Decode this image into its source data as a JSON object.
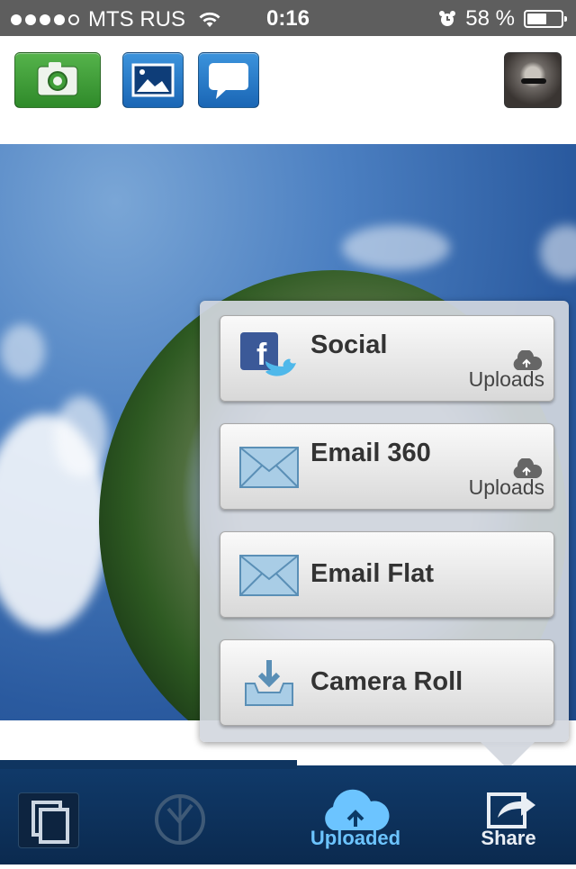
{
  "status_bar": {
    "carrier": "MTS RUS",
    "time": "0:16",
    "battery": "58 %",
    "battery_level": 0.58,
    "signal_bars_filled": 4,
    "signal_bars_total": 5
  },
  "toolbar": {
    "buttons": [
      {
        "name": "camera-button",
        "icon": "camera-icon",
        "color": "#3f9d38"
      },
      {
        "name": "gallery-button",
        "icon": "image-icon",
        "color": "#2a7dcc"
      },
      {
        "name": "chat-button",
        "icon": "speech-bubble-icon",
        "color": "#2a7dcc"
      }
    ],
    "avatar": "profile-avatar"
  },
  "share_menu": {
    "items": [
      {
        "label": "Social",
        "sub": "Uploads",
        "icon": "facebook-twitter-icon",
        "cloud": "cloud-upload-icon"
      },
      {
        "label": "Email 360",
        "sub": "Uploads",
        "icon": "envelope-icon",
        "cloud": "cloud-upload-icon"
      },
      {
        "label": "Email Flat",
        "icon": "envelope-icon"
      },
      {
        "label": "Camera Roll",
        "icon": "download-tray-icon"
      }
    ]
  },
  "tabbar": {
    "tabs": [
      {
        "name": "copy",
        "icon": "copy-icon"
      },
      {
        "name": "rotate",
        "icon": "rotate-icon"
      },
      {
        "label": "Uploaded",
        "icon": "cloud-upload-icon",
        "color": "#6cc4ff"
      },
      {
        "label": "Share",
        "icon": "share-icon",
        "color": "#e9eef4"
      }
    ]
  }
}
